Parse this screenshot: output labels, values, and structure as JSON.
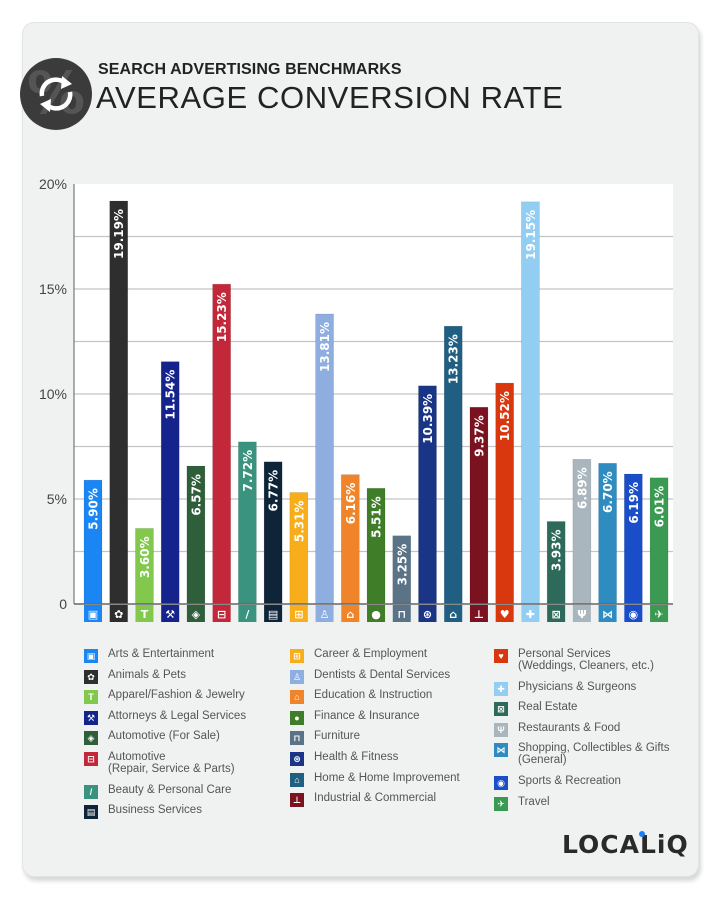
{
  "header": {
    "subtitle": "SEARCH ADVERTISING BENCHMARKS",
    "title": "AVERAGE CONVERSION RATE",
    "badge_icon": "refresh-percent-icon"
  },
  "brand": {
    "logo": "LOCALiQ",
    "dot_color": "#1a7ff5"
  },
  "chart_data": {
    "type": "bar",
    "title": "AVERAGE CONVERSION RATE",
    "subtitle": "SEARCH ADVERTISING BENCHMARKS",
    "xlabel": "",
    "ylabel": "",
    "ylim": [
      0,
      20
    ],
    "yticks": [
      0,
      5,
      10,
      15,
      20
    ],
    "ytick_labels": [
      "0",
      "5%",
      "10%",
      "15%",
      "20%"
    ],
    "gridlines": [
      2.5,
      5,
      7.5,
      10,
      12.5,
      15,
      17.5
    ],
    "grid": true,
    "legend_position": "bottom",
    "categories": [
      "Arts & Entertainment",
      "Animals & Pets",
      "Apparel/Fashion & Jewelry",
      "Attorneys & Legal Services",
      "Automotive (For Sale)",
      "Automotive (Repair, Service & Parts)",
      "Beauty & Personal Care",
      "Business Services",
      "Career & Employment",
      "Dentists & Dental Services",
      "Education & Instruction",
      "Finance & Insurance",
      "Furniture",
      "Health & Fitness",
      "Home & Home Improvement",
      "Industrial & Commercial",
      "Personal Services (Weddings, Cleaners, etc.)",
      "Physicians & Surgeons",
      "Real Estate",
      "Restaurants & Food",
      "Shopping, Collectibles & Gifts (General)",
      "Sports & Recreation",
      "Travel"
    ],
    "values": [
      5.9,
      19.19,
      3.6,
      11.54,
      6.57,
      15.23,
      7.72,
      6.77,
      5.31,
      13.81,
      6.16,
      5.51,
      3.25,
      10.39,
      13.23,
      9.37,
      10.52,
      19.15,
      3.93,
      6.89,
      6.7,
      6.19,
      6.01
    ],
    "value_labels": [
      "5.90%",
      "19.19%",
      "3.60%",
      "11.54%",
      "6.57%",
      "15.23%",
      "7.72%",
      "6.77%",
      "5.31%",
      "13.81%",
      "6.16%",
      "5.51%",
      "3.25%",
      "10.39%",
      "13.23%",
      "9.37%",
      "10.52%",
      "19.15%",
      "3.93%",
      "6.89%",
      "6.70%",
      "6.19%",
      "6.01%"
    ],
    "colors": [
      "#1a86f3",
      "#2e2e2e",
      "#82c84c",
      "#15238d",
      "#2f5e3a",
      "#c3283a",
      "#3a937e",
      "#0e2438",
      "#f8ae1a",
      "#8eaee0",
      "#f0842a",
      "#3f7d28",
      "#5a7386",
      "#1a3586",
      "#215f82",
      "#7b1220",
      "#d9380f",
      "#92cdf2",
      "#2e6a5a",
      "#a9b6bd",
      "#2e8cc0",
      "#1a4dc8",
      "#3a9a51"
    ],
    "icons": [
      "picture-icon",
      "paw-icon",
      "tshirt-icon",
      "gavel-icon",
      "price-tag-icon",
      "car-icon",
      "brush-icon",
      "document-icon",
      "briefcase-icon",
      "tooth-icon",
      "graduation-cap-icon",
      "piggy-bank-icon",
      "armchair-icon",
      "apple-tape-icon",
      "house-icon",
      "factory-icon",
      "hand-heart-icon",
      "medical-cross-icon",
      "storefront-icon",
      "fork-knife-icon",
      "gift-bow-icon",
      "ball-icon",
      "airplane-icon"
    ],
    "icon_glyphs": [
      "▣",
      "✿",
      "T",
      "⚒",
      "◈",
      "⊟",
      "/",
      "▤",
      "⊞",
      "♙",
      "⌂",
      "●",
      "⊓",
      "⊛",
      "⌂",
      "⊥",
      "♥",
      "✚",
      "⊠",
      "Ψ",
      "⋈",
      "◉",
      "✈"
    ]
  },
  "legend": {
    "columns": [
      [
        {
          "label": "Arts & Entertainment",
          "index": 0
        },
        {
          "label": "Animals & Pets",
          "index": 1
        },
        {
          "label": "Apparel/Fashion & Jewelry",
          "index": 2
        },
        {
          "label": "Attorneys & Legal Services",
          "index": 3
        },
        {
          "label": "Automotive (For Sale)",
          "index": 4
        },
        {
          "label": "Automotive\n(Repair, Service & Parts)",
          "index": 5
        },
        {
          "label": "Beauty & Personal Care",
          "index": 6
        },
        {
          "label": "Business Services",
          "index": 7
        }
      ],
      [
        {
          "label": "Career & Employment",
          "index": 8
        },
        {
          "label": "Dentists & Dental Services",
          "index": 9
        },
        {
          "label": "Education & Instruction",
          "index": 10
        },
        {
          "label": "Finance & Insurance",
          "index": 11
        },
        {
          "label": "Furniture",
          "index": 12
        },
        {
          "label": "Health & Fitness",
          "index": 13
        },
        {
          "label": "Home & Home Improvement",
          "index": 14
        },
        {
          "label": "Industrial & Commercial",
          "index": 15
        }
      ],
      [
        {
          "label": "Personal Services\n(Weddings, Cleaners, etc.)",
          "index": 16
        },
        {
          "label": "Physicians & Surgeons",
          "index": 17
        },
        {
          "label": "Real Estate",
          "index": 18
        },
        {
          "label": "Restaurants & Food",
          "index": 19
        },
        {
          "label": "Shopping, Collectibles & Gifts\n(General)",
          "index": 20
        },
        {
          "label": "Sports & Recreation",
          "index": 21
        },
        {
          "label": "Travel",
          "index": 22
        }
      ]
    ]
  }
}
